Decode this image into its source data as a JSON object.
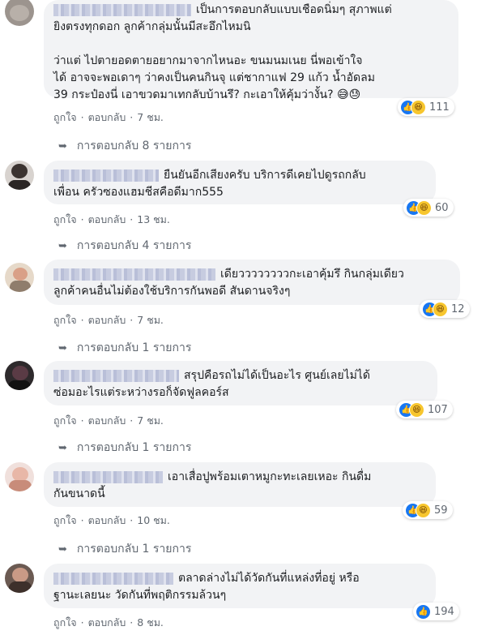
{
  "comments": [
    {
      "text": "เป็นการตอบกลับแบบเชือดนิ่มๆ สุภาพแต่\nยิงตรงทุกดอก ลูกค้ากลุ่มนั้นมีสะอึกไหมนิ\n\nว่าแต่ ไปตายอดตายอยากมาจากไหนอะ ขนมนมเนย นี่พอเข้าใจ\nได้ อาจจะพอเดาๆ ว่าคงเป็นคนกินจุ แต่ชากาแฟ 29 แก้ว น้ำอัดลม\n39 กระป๋องนี่ เอาขวดมาเทกลับบ้านรึ? กะเอาให้คุ้มว่างั้น? 😅😓",
      "reaction_count": "111",
      "like_label": "ถูกใจ",
      "reply_label": "ตอบกลับ",
      "time": "7 ชม.",
      "replies": "การตอบกลับ 8 รายการ"
    },
    {
      "text": "ยืนยันอีกเสียงครับ บริการดีเคยไปดูรถกลับ\nเพื่อน ครัวซองแฮมชีสคือดีมาก555",
      "reaction_count": "60",
      "like_label": "ถูกใจ",
      "reply_label": "ตอบกลับ",
      "time": "13 ชม.",
      "replies": "การตอบกลับ 4 รายการ"
    },
    {
      "text": "เดียววววววววกะเอาคุ้มรึ กินกลุ่มเดียว\nลูกค้าคนอื่นไม่ต้องใช้บริการกันพอดี สันดานจริงๆ",
      "reaction_count": "12",
      "like_label": "ถูกใจ",
      "reply_label": "ตอบกลับ",
      "time": "7 ชม.",
      "replies": "การตอบกลับ 1 รายการ"
    },
    {
      "text": "สรุปคือรถไม่ได้เป็นอะไร ศูนย์เลยไม่ได้\nซ่อมอะไรแต่ระหว่างรอก็จัดฟูลคอร์ส",
      "reaction_count": "107",
      "like_label": "ถูกใจ",
      "reply_label": "ตอบกลับ",
      "time": "7 ชม.",
      "replies": "การตอบกลับ 1 รายการ"
    },
    {
      "text": "เอาเสื่อปูพร้อมเตาหมูกะทะเลยเหอะ กินดื่ม\nกันขนาดนี้",
      "reaction_count": "59",
      "like_label": "ถูกใจ",
      "reply_label": "ตอบกลับ",
      "time": "10 ชม.",
      "replies": "การตอบกลับ 1 รายการ"
    },
    {
      "text": "ตลาดล่างไม่ได้วัดกันที่แหล่งที่อยู่ หรือ\nฐานะเลยนะ วัดกันที่พฤติกรรมล้วนๆ",
      "reaction_count": "194",
      "like_label": "ถูกใจ",
      "reply_label": "ตอบกลับ",
      "time": "8 ชม.",
      "replies": ""
    }
  ],
  "icons": {
    "like": "like-icon",
    "haha": "haha-icon",
    "sad": "sad-icon",
    "reply_arrow": "reply-arrow-icon"
  },
  "colors": {
    "like": "#1877f2",
    "haha": "#f7c62e",
    "bubble": "#f2f3f5",
    "meta": "#606770"
  }
}
